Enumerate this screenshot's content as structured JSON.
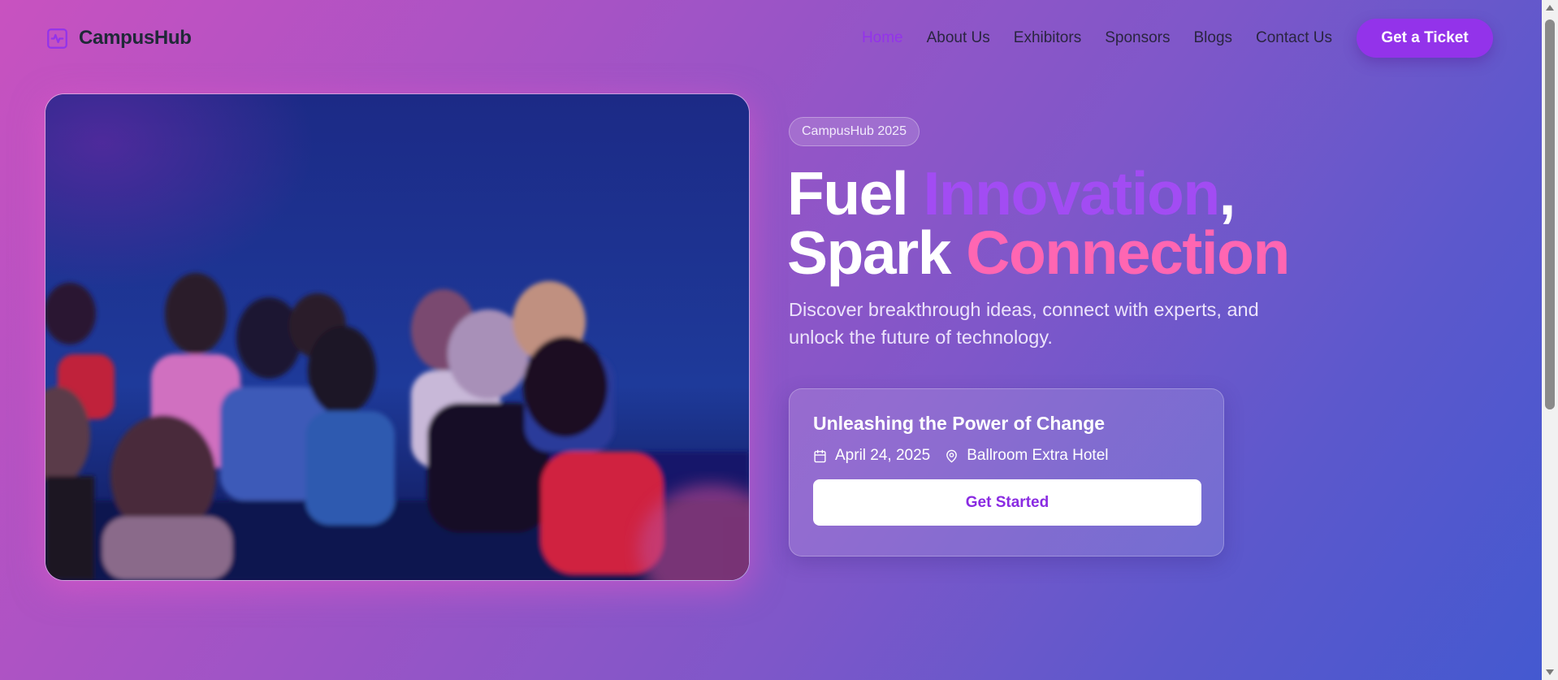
{
  "brand": {
    "name": "CampusHub",
    "icon": "activity-pulse-icon",
    "accent": "#9333ea"
  },
  "nav": {
    "items": [
      {
        "label": "Home",
        "active": true
      },
      {
        "label": "About Us"
      },
      {
        "label": "Exhibitors"
      },
      {
        "label": "Sponsors"
      },
      {
        "label": "Blogs"
      },
      {
        "label": "Contact Us"
      }
    ],
    "cta": "Get a Ticket"
  },
  "hero": {
    "badge": "CampusHub 2025",
    "headline": {
      "w1": "Fuel ",
      "w2": "Innovation",
      "w3": ",",
      "w4": "Spark ",
      "w5": "Connection"
    },
    "description": "Discover breakthrough ideas, connect with experts, and unlock the future of technology.",
    "colors": {
      "innovation": "#a24cf3",
      "connection": "#ff66b2"
    }
  },
  "event_card": {
    "title": "Unleashing the Power of Change",
    "date": "April 24, 2025",
    "date_icon": "calendar-icon",
    "location": "Ballroom Extra Hotel",
    "location_icon": "map-pin-icon",
    "button": "Get Started"
  }
}
